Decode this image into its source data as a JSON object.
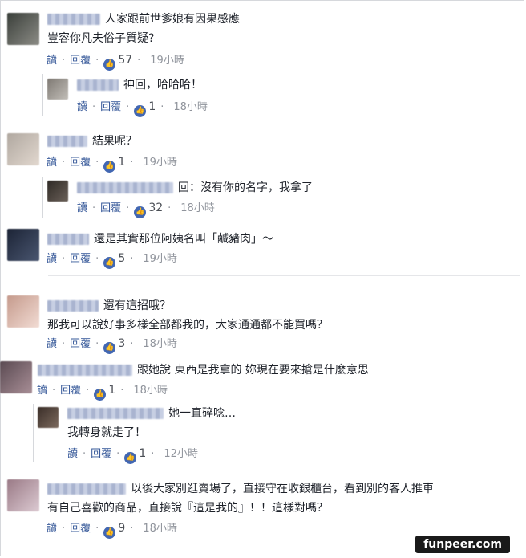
{
  "labels": {
    "read": "讀",
    "reply": "回覆",
    "separator": "·"
  },
  "comments": [
    {
      "text": "人家跟前世爹娘有因果感應",
      "text2": "豈容你凡夫俗子質疑?",
      "likes": "57",
      "time": "19小時"
    },
    {
      "text": "神回，哈哈哈！",
      "likes": "1",
      "time": "18小時"
    },
    {
      "text": "結果呢？",
      "likes": "1",
      "time": "19小時"
    },
    {
      "text": "回：沒有你的名字，我拿了",
      "likes": "32",
      "time": "18小時"
    },
    {
      "text": "還是其實那位阿姨名叫「鹹豬肉」～",
      "likes": "5",
      "time": "19小時"
    },
    {
      "text": "還有這招哦？",
      "text2": "那我可以說好事多樣全部都我的，大家通通都不能買嗎？",
      "likes": "3",
      "time": "18小時"
    },
    {
      "text": "跟她說 東西是我拿的 妳現在要來搶是什麼意思",
      "likes": "1",
      "time": "18小時"
    },
    {
      "text": "她一直碎唸…",
      "text2": "我轉身就走了！",
      "likes": "1",
      "time": "12小時"
    },
    {
      "text": "以後大家別逛賣場了，直接守在收銀櫃台，看到別的客人推車",
      "text2": "有自己喜歡的商品，直接說『這是我的』！！這樣對嗎？",
      "likes": "9",
      "time": "18小時"
    }
  ],
  "watermark": "funpeer.com",
  "colors": {
    "link": "#365899",
    "like": "#4267b2",
    "meta": "#90949c"
  },
  "icons": {
    "like": "thumbs-up-icon"
  }
}
